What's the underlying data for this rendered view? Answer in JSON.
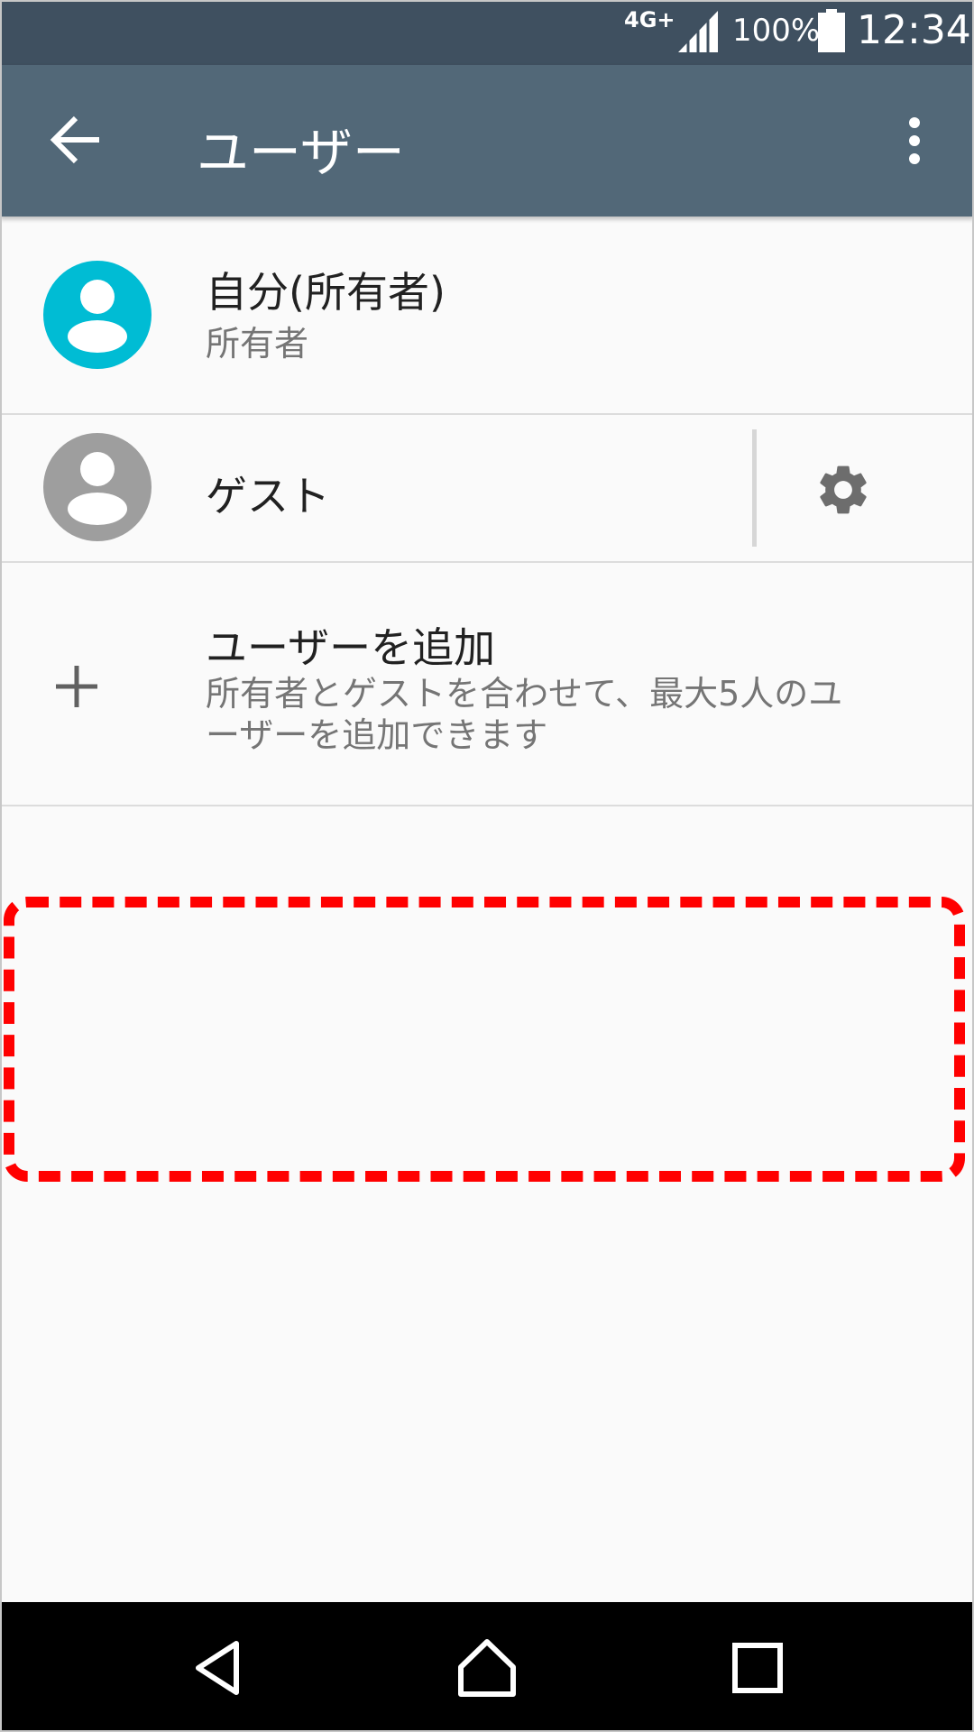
{
  "status_bar": {
    "network": "4G+",
    "battery_percent": "100%",
    "time": "12:34",
    "icons": [
      "signal-icon",
      "battery-icon"
    ]
  },
  "app_bar": {
    "title": "ユーザー",
    "icons": [
      "back-arrow-icon",
      "more-vert-icon"
    ]
  },
  "users": [
    {
      "name": "自分(所有者)",
      "role": "所有者",
      "avatar_color": "#00bcd4"
    },
    {
      "name": "ゲスト",
      "avatar_color": "#9e9e9e",
      "action_icon": "gear-icon"
    }
  ],
  "add_user": {
    "title": "ユーザーを追加",
    "description_line1": "所有者とゲストを合わせて、最大5人のユ",
    "description_line2": "ーザーを追加できます",
    "icon": "plus-icon"
  },
  "highlight_color": "#ff0000",
  "nav_bar": {
    "icons": [
      "back-triangle-icon",
      "home-icon",
      "recents-icon"
    ]
  }
}
